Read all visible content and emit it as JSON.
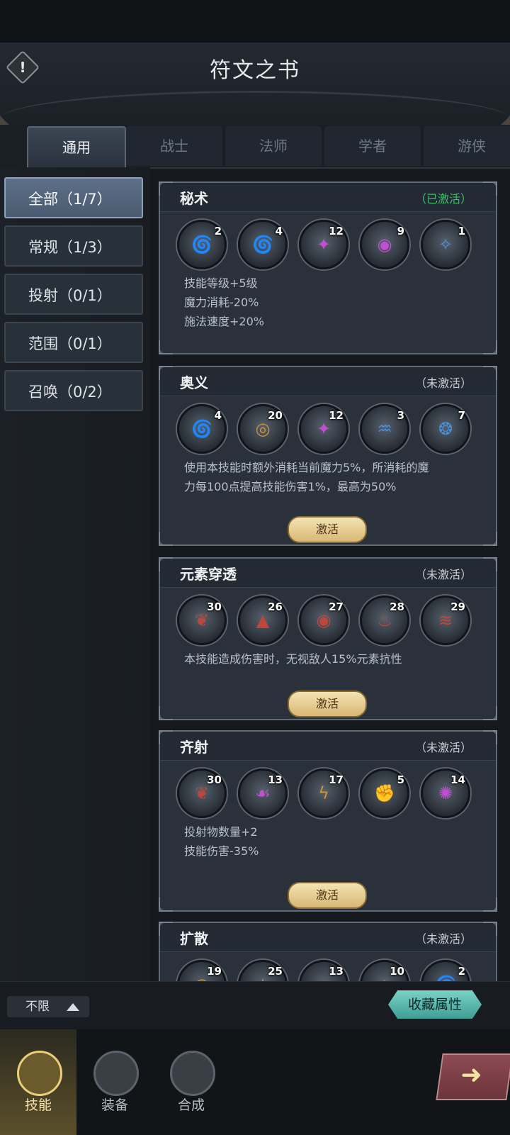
{
  "header": {
    "title": "符文之书",
    "info_icon": "exclamation-icon"
  },
  "tabs": [
    {
      "label": "通用",
      "active": true
    },
    {
      "label": "战士",
      "active": false
    },
    {
      "label": "法师",
      "active": false
    },
    {
      "label": "学者",
      "active": false
    },
    {
      "label": "游侠",
      "active": false
    }
  ],
  "sidebar": {
    "items": [
      {
        "label": "全部（1/7）",
        "active": true
      },
      {
        "label": "常规（1/3）",
        "active": false
      },
      {
        "label": "投射（0/1）",
        "active": false
      },
      {
        "label": "范围（0/1）",
        "active": false
      },
      {
        "label": "召唤（0/2）",
        "active": false
      }
    ]
  },
  "cards": [
    {
      "title": "秘术",
      "status": "（已激活）",
      "active": true,
      "runes": [
        {
          "num": "2",
          "glyph": "🌀",
          "color": "#4a90d9"
        },
        {
          "num": "4",
          "glyph": "🌀",
          "color": "#4a90d9"
        },
        {
          "num": "12",
          "glyph": "✦",
          "color": "#c24fd1"
        },
        {
          "num": "9",
          "glyph": "◉",
          "color": "#c24fd1"
        },
        {
          "num": "1",
          "glyph": "✧",
          "color": "#4a90d9"
        }
      ],
      "desc": [
        "技能等级+5级",
        "魔力消耗-20%",
        "施法速度+20%"
      ],
      "button": ""
    },
    {
      "title": "奥义",
      "status": "（未激活）",
      "active": false,
      "runes": [
        {
          "num": "4",
          "glyph": "🌀",
          "color": "#4a90d9"
        },
        {
          "num": "20",
          "glyph": "◎",
          "color": "#d19233"
        },
        {
          "num": "12",
          "glyph": "✦",
          "color": "#c24fd1"
        },
        {
          "num": "3",
          "glyph": "♒",
          "color": "#4a90d9"
        },
        {
          "num": "7",
          "glyph": "❂",
          "color": "#4a90d9"
        }
      ],
      "desc": [
        "使用本技能时额外消耗当前魔力5%，所消耗的魔",
        "力每100点提高技能伤害1%，最高为50%"
      ],
      "button": "激活"
    },
    {
      "title": "元素穿透",
      "status": "（未激活）",
      "active": false,
      "runes": [
        {
          "num": "30",
          "glyph": "❦",
          "color": "#c0463c"
        },
        {
          "num": "26",
          "glyph": "▲",
          "color": "#c0463c"
        },
        {
          "num": "27",
          "glyph": "◉",
          "color": "#c0463c"
        },
        {
          "num": "28",
          "glyph": "♨",
          "color": "#c0463c"
        },
        {
          "num": "29",
          "glyph": "≋",
          "color": "#c0463c"
        }
      ],
      "desc": [
        "本技能造成伤害时，无视敌人15%元素抗性"
      ],
      "button": "激活"
    },
    {
      "title": "齐射",
      "status": "（未激活）",
      "active": false,
      "runes": [
        {
          "num": "30",
          "glyph": "❦",
          "color": "#c0463c"
        },
        {
          "num": "13",
          "glyph": "☙",
          "color": "#c24fd1"
        },
        {
          "num": "17",
          "glyph": "ϟ",
          "color": "#d19233"
        },
        {
          "num": "5",
          "glyph": "✊",
          "color": "#4a90d9"
        },
        {
          "num": "14",
          "glyph": "✺",
          "color": "#c24fd1"
        }
      ],
      "desc": [
        "投射物数量+2",
        "技能伤害-35%"
      ],
      "button": "激活"
    },
    {
      "title": "扩散",
      "status": "（未激活）",
      "active": false,
      "runes": [
        {
          "num": "19",
          "glyph": "◎",
          "color": "#d19233"
        },
        {
          "num": "25",
          "glyph": "✶",
          "color": "#d19233"
        },
        {
          "num": "13",
          "glyph": "☙",
          "color": "#c24fd1"
        },
        {
          "num": "10",
          "glyph": "▲",
          "color": "#c24fd1"
        },
        {
          "num": "2",
          "glyph": "🌀",
          "color": "#4a90d9"
        }
      ],
      "desc": [],
      "button": ""
    }
  ],
  "footer": {
    "filter_label": "不限",
    "fav_label": "收藏属性"
  },
  "nav": [
    {
      "label": "技能",
      "icon": "sword-icon",
      "active": true
    },
    {
      "label": "装备",
      "icon": "armor-icon",
      "active": false
    },
    {
      "label": "合成",
      "icon": "synthesis-icon",
      "active": false
    }
  ],
  "go_button_icon": "arrow-right-icon"
}
